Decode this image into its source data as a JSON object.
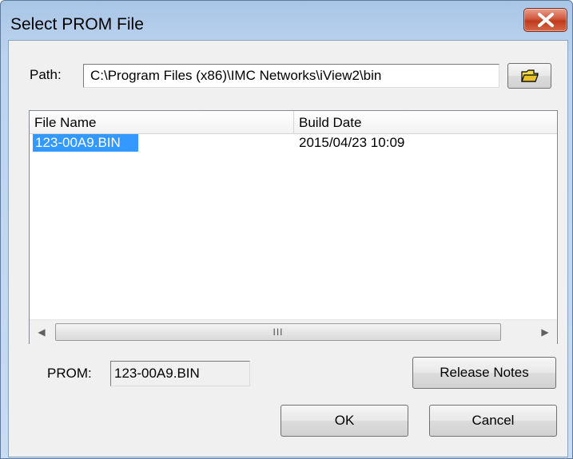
{
  "window": {
    "title": "Select PROM File",
    "close_icon": "close-x-icon"
  },
  "path": {
    "label": "Path:",
    "value": "C:\\Program Files (x86)\\IMC Networks\\iView2\\bin",
    "browse_icon": "folder-open-icon"
  },
  "file_list": {
    "columns": [
      "File Name",
      "Build Date"
    ],
    "rows": [
      {
        "name": "123-00A9.BIN",
        "date": "2015/04/23 10:09",
        "selected": true
      }
    ],
    "scrollbar_grip": "III"
  },
  "prom": {
    "label": "PROM:",
    "value": "123-00A9.BIN"
  },
  "buttons": {
    "release_notes": "Release Notes",
    "ok": "OK",
    "cancel": "Cancel"
  },
  "colors": {
    "selection": "#3399ff",
    "close_button": "#c8452a"
  }
}
